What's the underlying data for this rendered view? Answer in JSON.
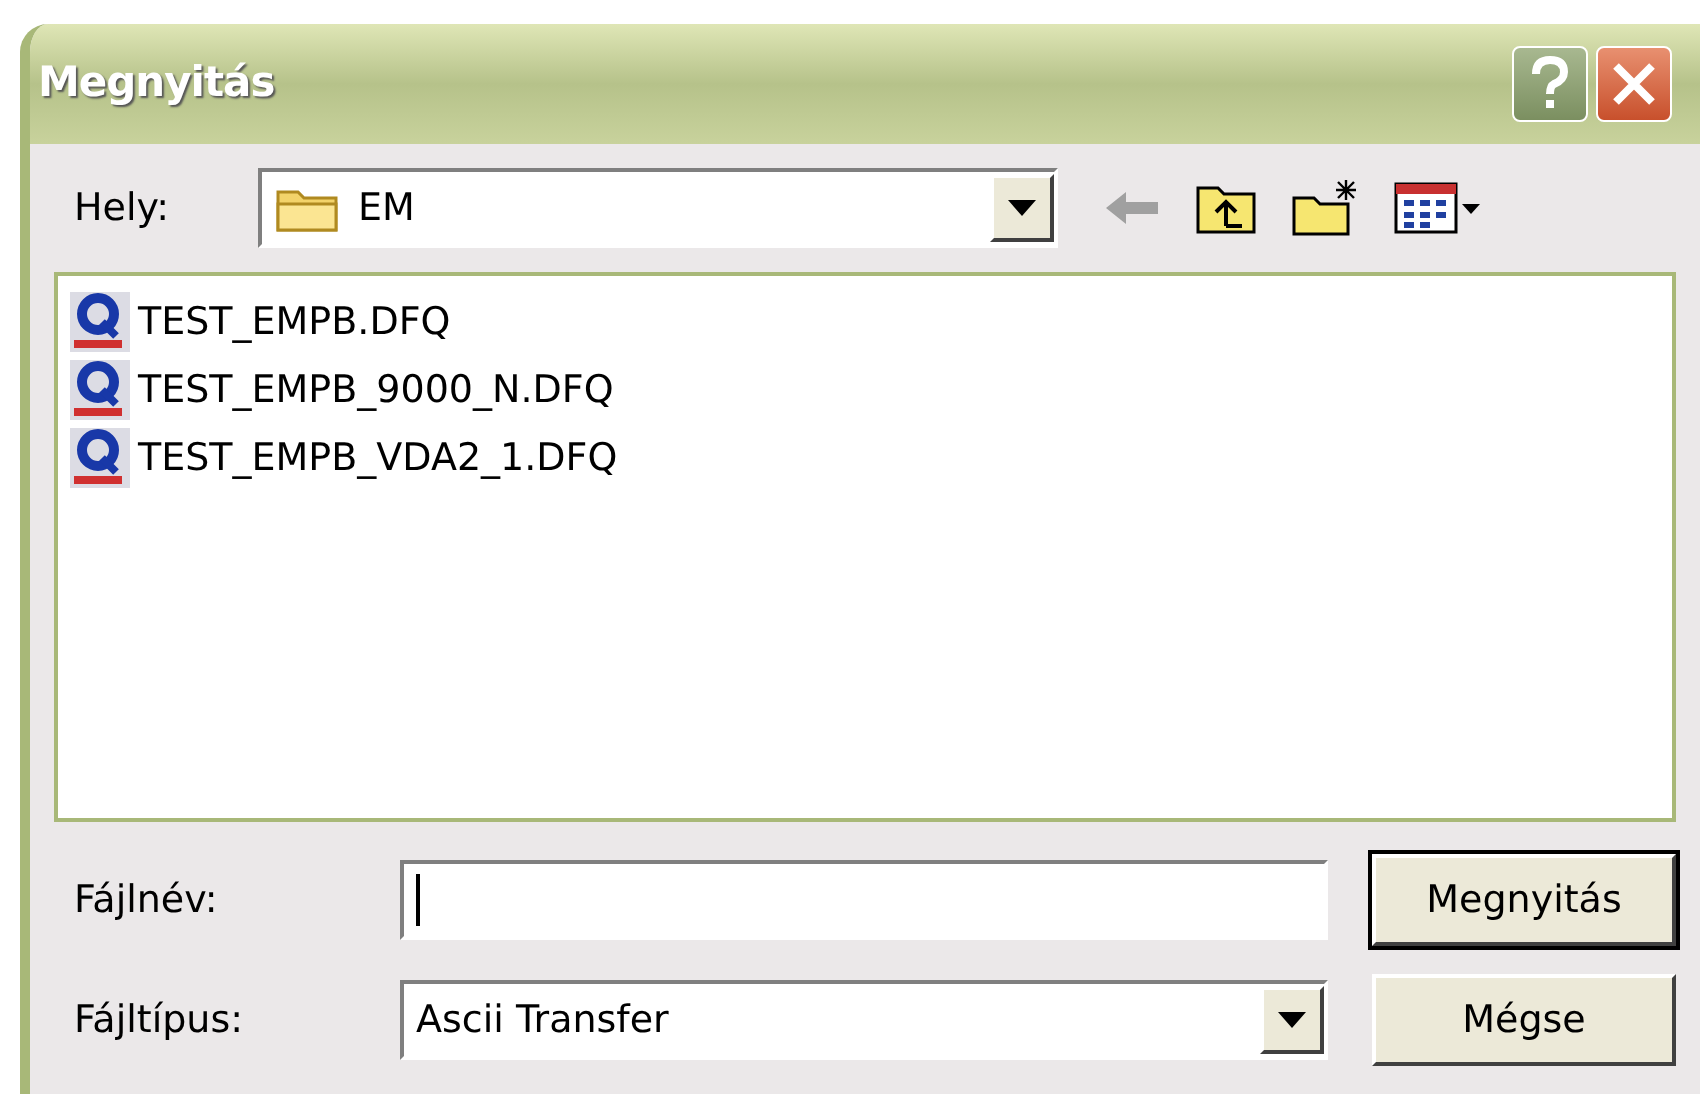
{
  "window": {
    "title": "Megnyitás"
  },
  "location": {
    "label": "Hely:",
    "value": "EM"
  },
  "files": [
    {
      "name": "TEST_EMPB.DFQ",
      "selected": false
    },
    {
      "name": "TEST_EMPB_9000_N.DFQ",
      "selected": false
    },
    {
      "name": "TEST_EMPB_VDA2_1.DFQ",
      "selected": false
    }
  ],
  "filename": {
    "label": "Fájlnév:"
  },
  "filetype": {
    "label": "Fájltípus:",
    "value": "Ascii Transfer"
  },
  "buttons": [
    {
      "label": "Megnyitás",
      "default": true
    },
    {
      "label": "Mégse",
      "default": false
    }
  ]
}
